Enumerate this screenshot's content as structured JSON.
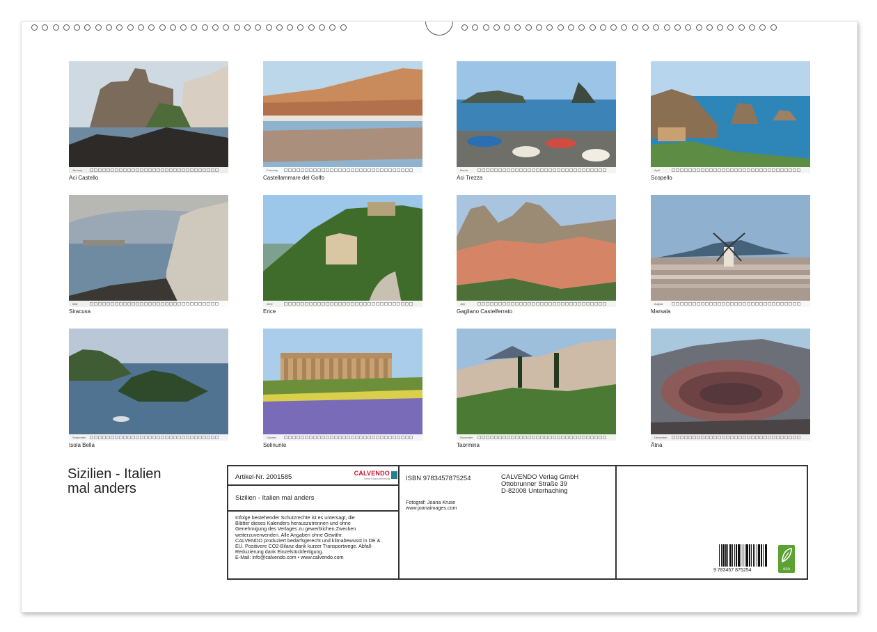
{
  "calendar_title_line1": "Sizilien - Italien",
  "calendar_title_line2": "mal anders",
  "months": [
    {
      "month": "January",
      "caption": "Aci Castello"
    },
    {
      "month": "February",
      "caption": "Castellammare del Golfo"
    },
    {
      "month": "March",
      "caption": "Aci Trezza"
    },
    {
      "month": "April",
      "caption": "Scopello"
    },
    {
      "month": "May",
      "caption": "Siracusa"
    },
    {
      "month": "June",
      "caption": "Erice"
    },
    {
      "month": "July",
      "caption": "Gagliano Castelferrato"
    },
    {
      "month": "August",
      "caption": "Marsala"
    },
    {
      "month": "September",
      "caption": "Isola Bella"
    },
    {
      "month": "October",
      "caption": "Selinunte"
    },
    {
      "month": "November",
      "caption": "Taormina"
    },
    {
      "month": "December",
      "caption": "Ätna"
    }
  ],
  "info": {
    "article_no": "Artikel-Nr. 2001585",
    "publisher_brand": "CALVENDO",
    "publisher_tagline": "Mein Kalenderverlag",
    "product_title": "Sizilien - Italien mal anders",
    "legal_lines": [
      "Infolge bestehender Schutzrechte ist es untersagt, die",
      "Blätter dieses Kalenders herauszutrennen und ohne",
      "Genehmigung des Verlages zu gewerblichen Zwecken",
      "weiterzuverwenden. Alle Angaben ohne Gewähr.",
      "CALVENDO produziert bedarfsgerecht und klimabewusst in DE &",
      "EU. Positivere CO2-Bilanz dank kurzer Transportwege. Abfall-",
      "Reduzierung dank Einzelstückfertigung.",
      "E-Mail: info@calvendo.com • www.calvendo.com"
    ],
    "isbn": "ISBN 9783457875254",
    "publisher_address": [
      "CALVENDO Verlag GmbH",
      "Ottobrunner Straße 39",
      "D-82008 Unterhaching"
    ],
    "photographer": "Fotograf: Joana Kruse",
    "photographer_url": "www.joanaimages.com",
    "barcode_digits": "9 783457 875254",
    "eco_label": "eco"
  }
}
